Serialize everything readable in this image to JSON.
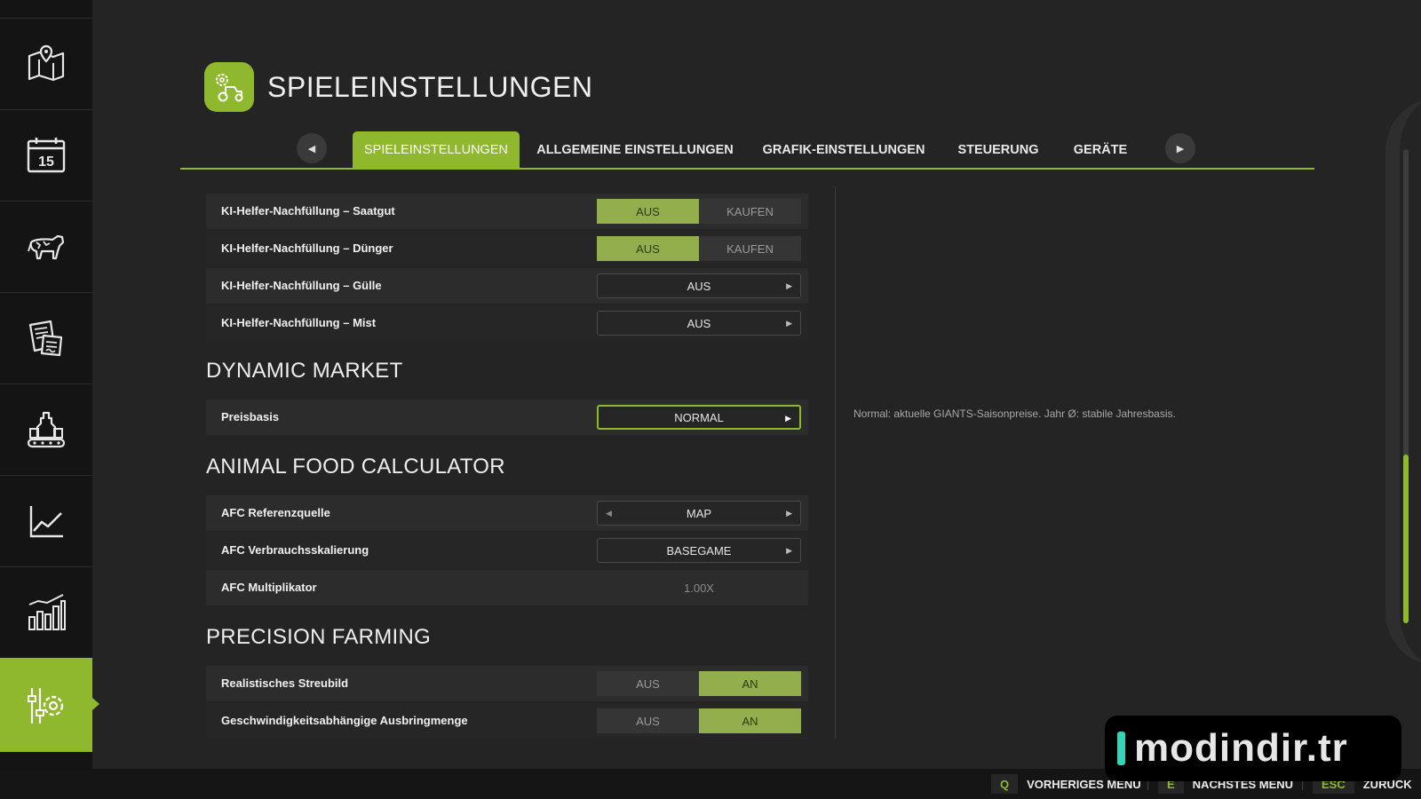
{
  "page": {
    "title": "SPIELEINSTELLUNGEN"
  },
  "tabs": [
    {
      "label": "SPIELEINSTELLUNGEN",
      "active": true
    },
    {
      "label": "ALLGEMEINE EINSTELLUNGEN"
    },
    {
      "label": "GRAFIK-EINSTELLUNGEN"
    },
    {
      "label": "STEUERUNG"
    },
    {
      "label": "GERÄTE"
    }
  ],
  "sidebar": {
    "items": [
      {
        "icon": "map-icon"
      },
      {
        "icon": "calendar-icon",
        "text": "15"
      },
      {
        "icon": "cow-icon"
      },
      {
        "icon": "contracts-icon"
      },
      {
        "icon": "production-icon"
      },
      {
        "icon": "line-chart-icon"
      },
      {
        "icon": "bar-chart-icon"
      },
      {
        "icon": "settings-icon",
        "active": true
      }
    ]
  },
  "options": {
    "off": "AUS",
    "buy": "KAUFEN",
    "on": "AN"
  },
  "settings": {
    "ki_saatgut": {
      "label": "KI-Helfer-Nachfüllung – Saatgut",
      "value": "AUS"
    },
    "ki_duenger": {
      "label": "KI-Helfer-Nachfüllung – Dünger",
      "value": "AUS"
    },
    "ki_guelle": {
      "label": "KI-Helfer-Nachfüllung – Gülle",
      "value": "AUS"
    },
    "ki_mist": {
      "label": "KI-Helfer-Nachfüllung – Mist",
      "value": "AUS"
    }
  },
  "dynamic_market": {
    "title": "DYNAMIC MARKET",
    "preisbasis": {
      "label": "Preisbasis",
      "value": "NORMAL"
    }
  },
  "afc": {
    "title": "ANIMAL FOOD CALCULATOR",
    "referenzquelle": {
      "label": "AFC Referenzquelle",
      "value": "MAP"
    },
    "verbrauchsskalierung": {
      "label": "AFC Verbrauchsskalierung",
      "value": "BASEGAME"
    },
    "multiplikator": {
      "label": "AFC Multiplikator",
      "value": "1.00X"
    }
  },
  "precision_farming": {
    "title": "PRECISION FARMING",
    "streubild": {
      "label": "Realistisches Streubild",
      "value": "AN"
    },
    "ausbringmenge": {
      "label": "Geschwindigkeitsabhängige Ausbringmenge",
      "value": "AN"
    }
  },
  "help": {
    "text": "Normal: aktuelle GIANTS-Saisonpreise. Jahr Ø: stabile Jahresbasis."
  },
  "bottom": {
    "prev": {
      "key": "Q",
      "label": "VORHERIGES MENÜ"
    },
    "next": {
      "key": "E",
      "label": "NÄCHSTES MENÜ"
    },
    "back": {
      "key": "ESC",
      "label": "ZURÜCK"
    }
  },
  "watermark": {
    "text": "modindir.tr"
  },
  "colors": {
    "accent": "#8fb82e",
    "toggle_on": "#93ae4d",
    "background": "#242424",
    "sidebar": "#141414"
  }
}
